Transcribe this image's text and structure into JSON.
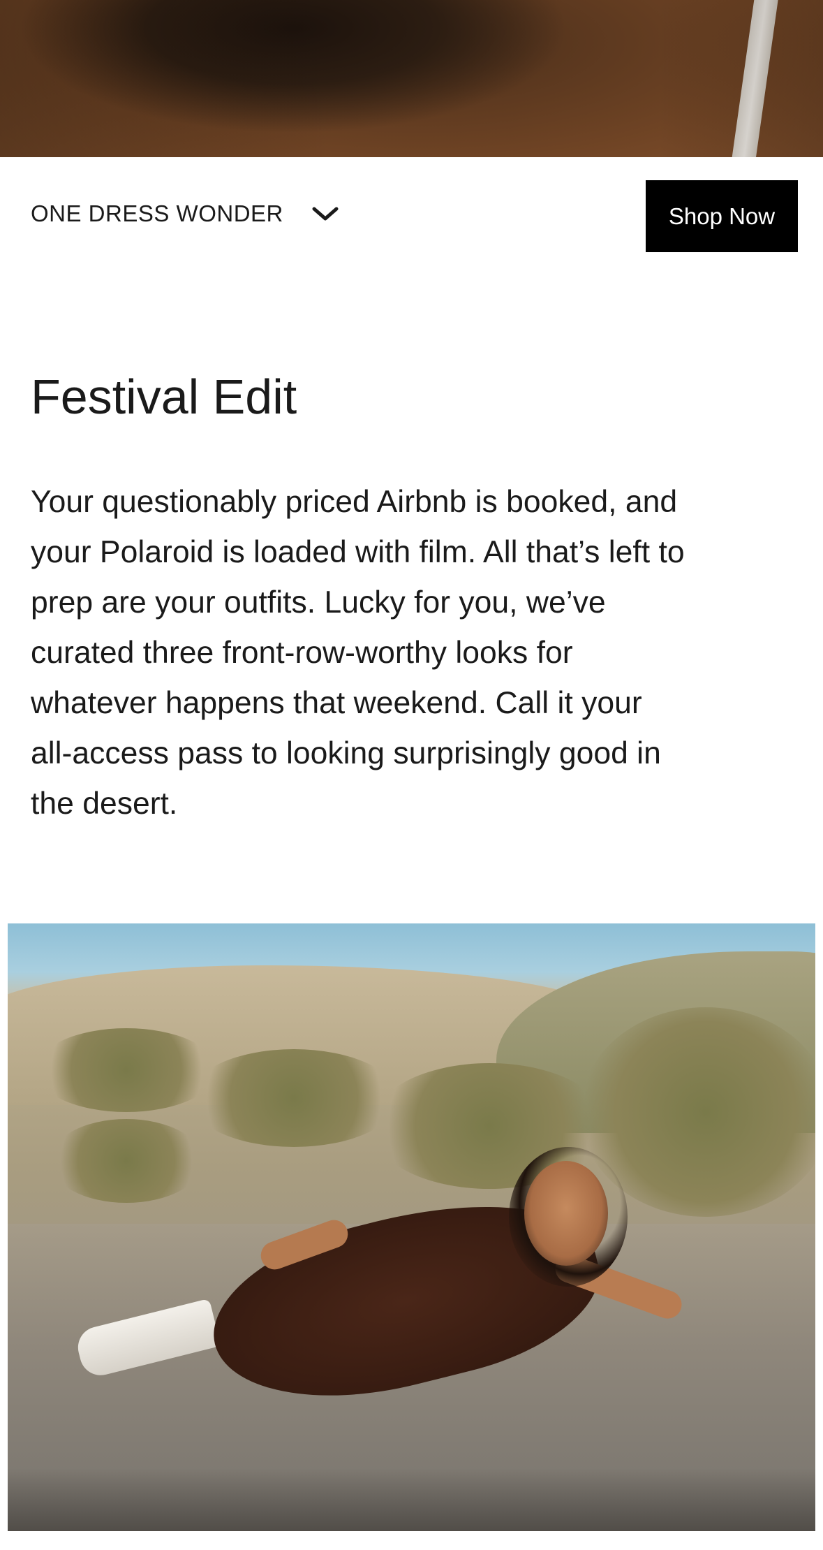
{
  "product_bar": {
    "product_name": "ONE DRESS WONDER",
    "shop_button_label": "Shop Now"
  },
  "editorial": {
    "title": "Festival Edit",
    "body_lines": [
      "Your questionably priced Airbnb is booked, and",
      "your Polaroid is loaded with film. All that’s left to",
      "prep are your outfits. Lucky for you, we’ve",
      "curated three front-row-worthy looks for",
      "whatever happens that weekend. Call it your",
      "all-access pass to looking surprisingly good in",
      "the desert."
    ]
  },
  "colors": {
    "button_bg": "#000000",
    "button_text": "#ffffff",
    "text": "#1a1a1a",
    "background": "#ffffff"
  },
  "icons": {
    "chevron": "chevron-down-icon"
  }
}
